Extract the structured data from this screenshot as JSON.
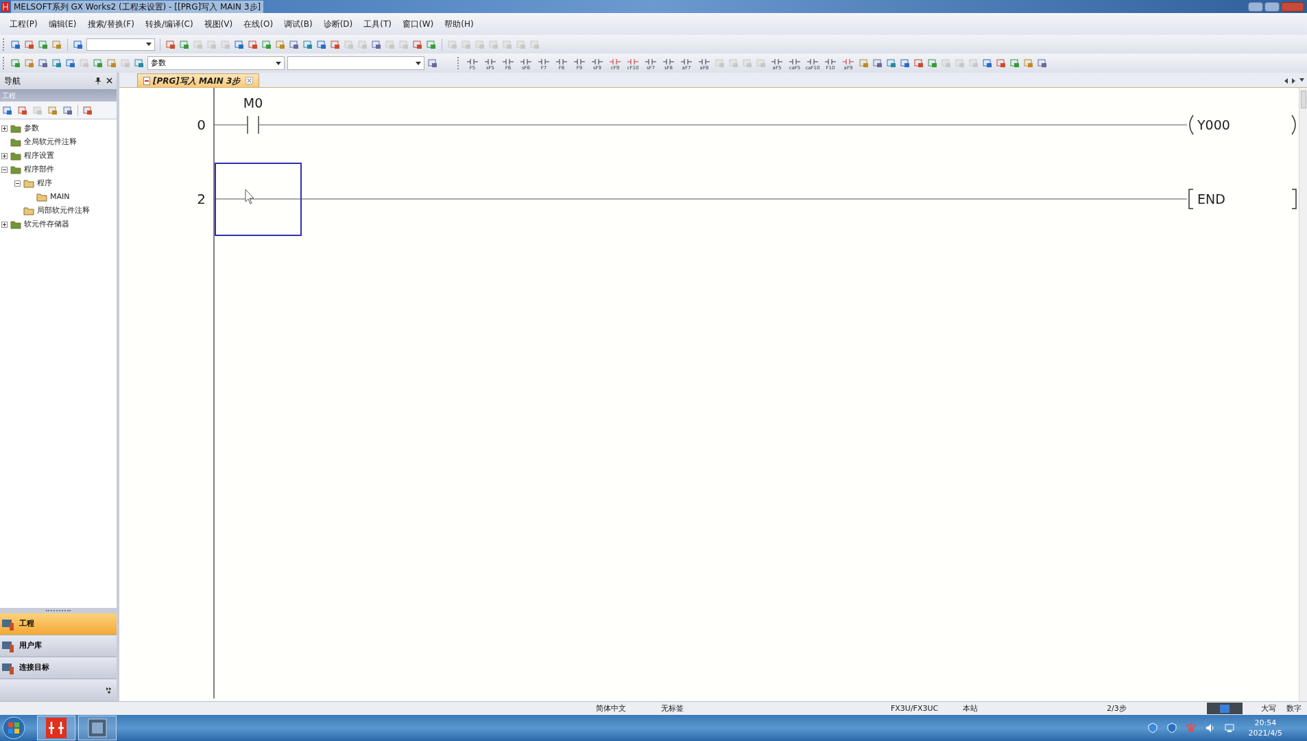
{
  "window": {
    "title": "MELSOFT系列 GX Works2 (工程未设置) - [[PRG]写入 MAIN 3步]"
  },
  "menu": [
    "工程(P)",
    "编辑(E)",
    "搜索/替换(F)",
    "转换/编译(C)",
    "视图(V)",
    "在线(O)",
    "调试(B)",
    "诊断(D)",
    "工具(T)",
    "窗口(W)",
    "帮助(H)"
  ],
  "toolbar": {
    "combo": {
      "value": "参数"
    }
  },
  "function_keys": [
    "F5",
    "sF5",
    "F6",
    "sF6",
    "F7",
    "F8",
    "F9",
    "sF9",
    "cF9",
    "cF10",
    "sF7",
    "sF8",
    "aF7",
    "aF8",
    "aF5",
    "caF5",
    "caF10",
    "F10",
    "aF9"
  ],
  "navigator": {
    "title": "导航",
    "section": "工程",
    "tree": [
      {
        "label": "参数",
        "expanded": false
      },
      {
        "label": "全局软元件注释"
      },
      {
        "label": "程序设置",
        "expanded": false
      },
      {
        "label": "程序部件",
        "expanded": true,
        "children": [
          {
            "label": "程序",
            "expanded": true,
            "children": [
              {
                "label": "MAIN"
              }
            ]
          },
          {
            "label": "局部软元件注释"
          }
        ]
      },
      {
        "label": "软元件存储器",
        "expanded": false
      }
    ],
    "buttons": [
      {
        "label": "工程",
        "selected": true
      },
      {
        "label": "用户库",
        "selected": false
      },
      {
        "label": "连接目标",
        "selected": false
      }
    ]
  },
  "tabs": [
    {
      "label": "[PRG]写入 MAIN 3步",
      "selected": true
    }
  ],
  "ladder": [
    {
      "step": "0",
      "contact": "M0",
      "output": {
        "kind": "coil",
        "device": "Y000"
      },
      "cursor": false
    },
    {
      "step": "2",
      "output": {
        "kind": "instruction",
        "device": "END"
      },
      "cursor": true
    }
  ],
  "status_bar": [
    "简体中文",
    "无标签",
    "FX3U/FX3UC",
    "本站",
    "2/3步",
    "大写",
    "数字"
  ],
  "taskbar": {
    "time": "20:54",
    "date": "2021/4/5"
  }
}
